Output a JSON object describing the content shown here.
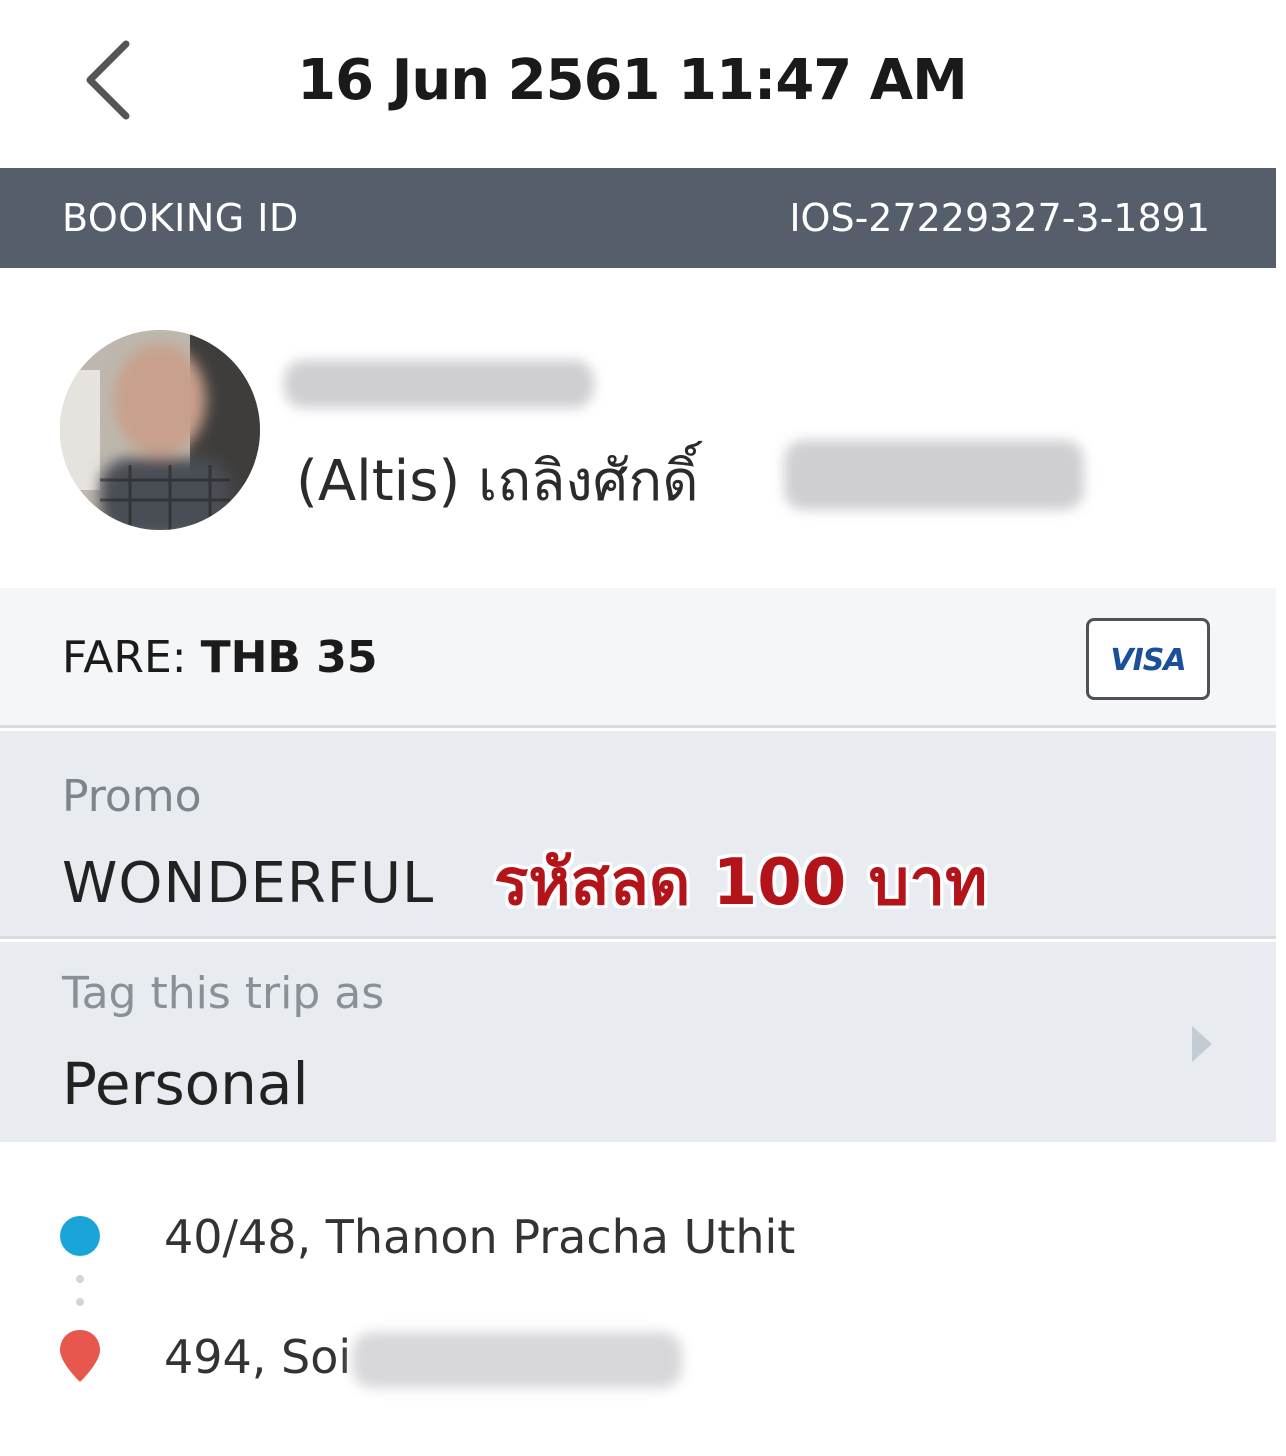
{
  "header": {
    "title": "16 Jun 2561 11:47 AM",
    "back_icon": "chevron-left-icon"
  },
  "booking": {
    "label": "BOOKING ID",
    "value": "IOS-27229327-3-1891"
  },
  "driver": {
    "vehicle_and_name": "(Altis) เถลิงศักดิ์"
  },
  "fare": {
    "label": "FARE:",
    "amount": "THB 35",
    "payment_badge": "VISA"
  },
  "promo": {
    "label": "Promo",
    "code": "WONDERFUL",
    "annotation": "รหัสลด 100 บาท"
  },
  "tag": {
    "label": "Tag this trip as",
    "value": "Personal"
  },
  "route": {
    "pickup": "40/48, Thanon Pracha Uthit",
    "dropoff": "494, Soi"
  },
  "colors": {
    "booking_bar": "#575e6b",
    "pickup_dot": "#1aa5d9",
    "dropoff_pin": "#e8574e",
    "annotation": "#b3141a"
  }
}
